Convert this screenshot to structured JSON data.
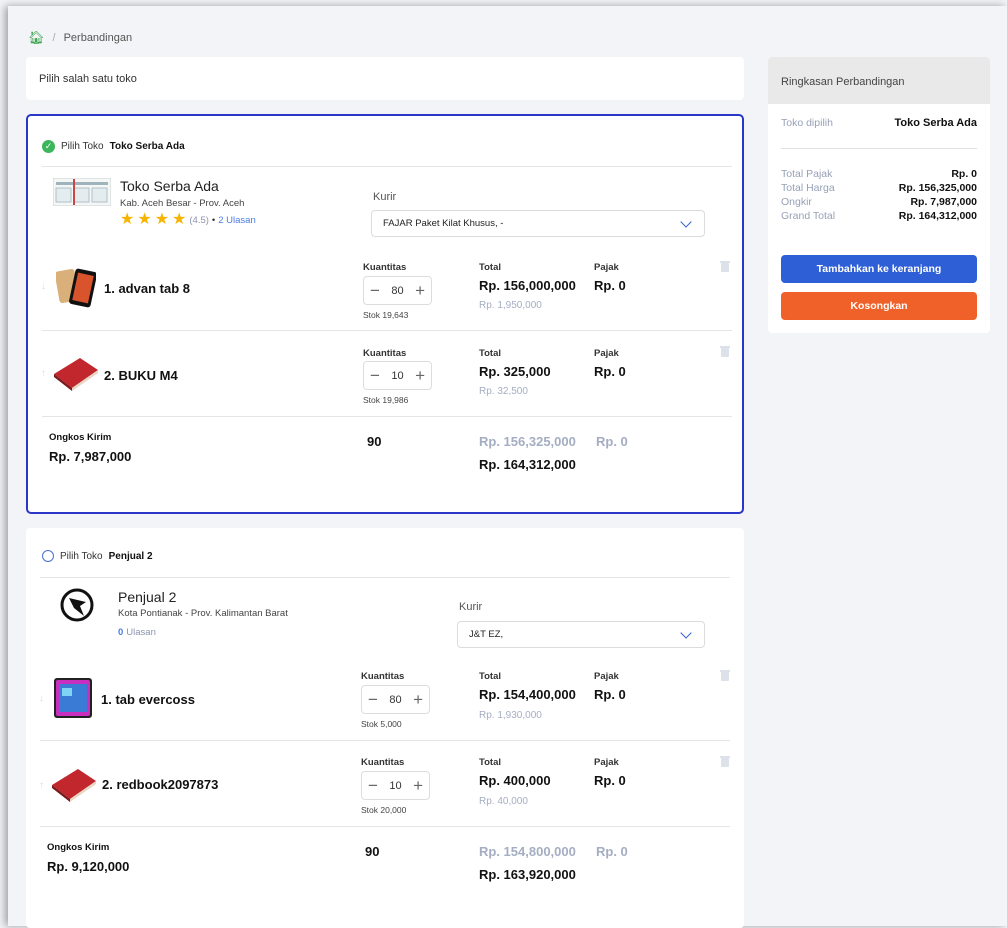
{
  "breadcrumb": {
    "current": "Perbandingan"
  },
  "hint": "Pilih salah satu toko",
  "pick_prefix": "Pilih Toko",
  "labels": {
    "kurir": "Kurir",
    "kuantitas": "Kuantitas",
    "total": "Total",
    "pajak": "Pajak",
    "ongkos": "Ongkos Kirim"
  },
  "stores": [
    {
      "name": "Toko Serba Ada",
      "location": "Kab. Aceh Besar - Prov. Aceh",
      "rating": "(4.5)",
      "bullet": "•",
      "reviews": "2 Ulasan",
      "courier": "FAJAR Paket Kilat Khusus, -",
      "selected": true,
      "products": [
        {
          "name": "1. advan tab 8",
          "qty": "80",
          "stock": "Stok 19,643",
          "total": "Rp. 156,000,000",
          "unit": "Rp. 1,950,000",
          "tax": "Rp. 0"
        },
        {
          "name": "2. BUKU M4",
          "qty": "10",
          "stock": "Stok 19,986",
          "total": "Rp. 325,000",
          "unit": "Rp. 32,500",
          "tax": "Rp. 0"
        }
      ],
      "shipping": "Rp. 7,987,000",
      "weight": "90",
      "subtotal": "Rp. 156,325,000",
      "subtax": "Rp. 0",
      "grand": "Rp. 164,312,000"
    },
    {
      "name": "Penjual 2",
      "location": "Kota Pontianak - Prov. Kalimantan Barat",
      "reviews_count": "0",
      "reviews_word": "Ulasan",
      "courier": "J&T EZ,",
      "selected": false,
      "products": [
        {
          "name": "1. tab evercoss",
          "qty": "80",
          "stock": "Stok 5,000",
          "total": "Rp. 154,400,000",
          "unit": "Rp. 1,930,000",
          "tax": "Rp. 0"
        },
        {
          "name": "2. redbook2097873",
          "qty": "10",
          "stock": "Stok 20,000",
          "total": "Rp. 400,000",
          "unit": "Rp. 40,000",
          "tax": "Rp. 0"
        }
      ],
      "shipping": "Rp. 9,120,000",
      "weight": "90",
      "subtotal": "Rp. 154,800,000",
      "subtax": "Rp. 0",
      "grand": "Rp. 163,920,000"
    }
  ],
  "summary": {
    "title": "Ringkasan Perbandingan",
    "chosen_label": "Toko dipilih",
    "chosen_value": "Toko Serba Ada",
    "rows": [
      {
        "k": "Total Pajak",
        "v": "Rp. 0"
      },
      {
        "k": "Total Harga",
        "v": "Rp. 156,325,000"
      },
      {
        "k": "Ongkir",
        "v": "Rp. 7,987,000"
      },
      {
        "k": "Grand Total",
        "v": "Rp. 164,312,000"
      }
    ],
    "add_button": "Tambahkan ke keranjang",
    "clear_button": "Kosongkan"
  },
  "colors": {
    "primary": "#2f5fd6",
    "danger": "#f0612a",
    "success": "#3cb65a",
    "selected_border": "#2a36c7"
  },
  "icons": [
    "home-icon",
    "check-circle-icon",
    "radio-icon",
    "star-icon",
    "chevron-down-icon",
    "trash-icon",
    "arrow-down-icon",
    "arrow-up-icon",
    "minus-icon",
    "plus-icon"
  ]
}
